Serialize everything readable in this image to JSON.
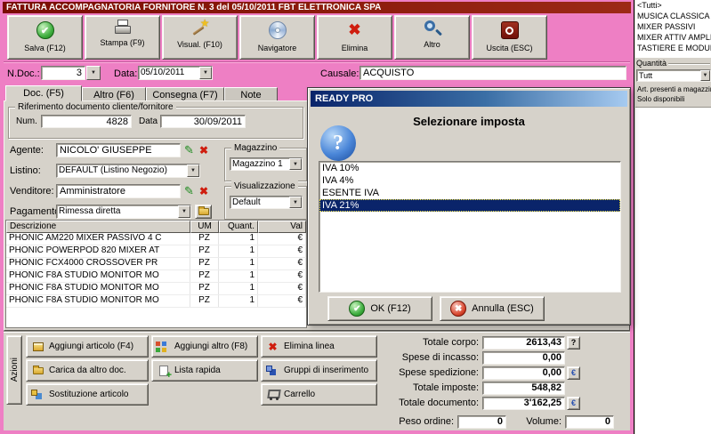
{
  "window": {
    "title": "FATTURA ACCOMPAGNATORIA FORNITORE N. 3  del 05/10/2011    FBT ELETTRONICA SPA"
  },
  "toolbar": {
    "buttons": [
      "Salva  (F12)",
      "Stampa  (F9)",
      "Visual.  (F10)",
      "Navigatore",
      "Elimina",
      "Altro",
      "Uscita (ESC)"
    ]
  },
  "doc_header": {
    "ndoc_label": "N.Doc.:",
    "ndoc_value": "3",
    "data_label": "Data:",
    "data_value": "05/10/2011",
    "causale_label": "Causale:",
    "causale_value": "ACQUISTO"
  },
  "tabs": [
    "Doc.  (F5)",
    "Altro (F6)",
    "Consegna (F7)",
    "Note"
  ],
  "reference": {
    "group_title": "Riferimento documento cliente/fornitore",
    "num_label": "Num.",
    "num_value": "4828",
    "data_label": "Data",
    "data_value": "30/09/2011"
  },
  "form": {
    "agente_label": "Agente:",
    "agente_value": "NICOLO' GIUSEPPE",
    "listino_label": "Listino:",
    "listino_value": "DEFAULT (Listino Negozio)",
    "venditore_label": "Venditore:",
    "venditore_value": "Amministratore",
    "pagamento_label": "Pagamento:",
    "pagamento_value": "Rimessa diretta",
    "magazzino_group": "Magazzino",
    "magazzino_value": "Magazzino 1",
    "visualizzazione_group": "Visualizzazione",
    "visualizzazione_value": "Default"
  },
  "items_table": {
    "columns": [
      "Descrizione",
      "UM",
      "Quant.",
      "Val"
    ],
    "rows": [
      [
        "PHONIC AM220 MIXER PASSIVO 4 C",
        "PZ",
        "1",
        "€"
      ],
      [
        "PHONIC POWERPOD 820 MIXER AT",
        "PZ",
        "1",
        "€"
      ],
      [
        "PHONIC FCX4000  CROSSOVER PR",
        "PZ",
        "1",
        "€"
      ],
      [
        "PHONIC F8A STUDIO MONITOR MO",
        "PZ",
        "1",
        "€"
      ],
      [
        "PHONIC F8A STUDIO MONITOR MO",
        "PZ",
        "1",
        "€"
      ],
      [
        "PHONIC F8A STUDIO MONITOR MO",
        "PZ",
        "1",
        "€"
      ]
    ]
  },
  "actions": {
    "tab_label": "Azioni",
    "buttons": [
      "Aggiungi articolo (F4)",
      "Aggiungi altro (F8)",
      "Elimina linea",
      "Carica da altro doc.",
      "Lista rapida",
      "Gruppi di inserimento",
      "Sostituzione articolo",
      "Carrello"
    ]
  },
  "totals": {
    "totale_corpo_label": "Totale corpo:",
    "totale_corpo_value": "2613,43",
    "spese_incasso_label": "Spese di incasso:",
    "spese_incasso_value": "0,00",
    "spese_spedizione_label": "Spese spedizione:",
    "spese_spedizione_value": "0,00",
    "totale_imposte_label": "Totale imposte:",
    "totale_imposte_value": "548,82",
    "totale_documento_label": "Totale documento:",
    "totale_documento_value": "3'162,25",
    "peso_label": "Peso ordine:",
    "peso_value": "0",
    "volume_label": "Volume:",
    "volume_value": "0",
    "help_button": "?",
    "euro_button": "€"
  },
  "modal": {
    "title": "READY PRO",
    "heading": "Selezionare imposta",
    "options": [
      "IVA 10%",
      "IVA 4%",
      "ESENTE IVA",
      "IVA 21%"
    ],
    "selected": "IVA 21%",
    "ok_label": "OK (F12)",
    "cancel_label": "Annulla (ESC)"
  },
  "sidebar": {
    "categories": [
      "<Tutti>",
      "MUSICA CLASSICA",
      "MIXER PASSIVI",
      "MIXER ATTIV AMPLIF",
      "TASTIERE E MODULI"
    ],
    "quantita_label": "Quantità",
    "quantita_value": "Tutt",
    "option1": "Art. presenti a magazzin",
    "option2": "Solo disponibili"
  },
  "colors": {
    "frame_pink": "#ee7fc4",
    "titlebar_red": "#7a0c02",
    "selection_blue": "#0a246a",
    "window_gray": "#d6d2ca"
  }
}
